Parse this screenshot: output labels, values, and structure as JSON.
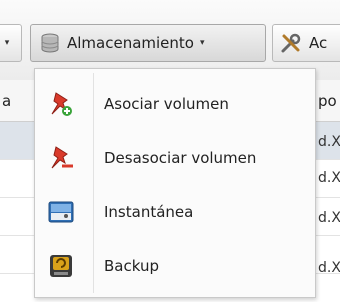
{
  "toolbar": {
    "storage_label": "Almacenamiento",
    "next_label": "Ac",
    "caret": "▾"
  },
  "grid": {
    "header_left": "a",
    "header_right": "po",
    "rows": [
      {
        "right": "d.X"
      },
      {
        "right": "d.X"
      },
      {
        "right": "d.X"
      },
      {
        "right": "d.X"
      }
    ]
  },
  "menu": {
    "items": [
      {
        "label": "Asociar volumen",
        "icon": "pin-add-icon"
      },
      {
        "label": "Desasociar volumen",
        "icon": "pin-remove-icon"
      },
      {
        "label": "Instantánea",
        "icon": "snapshot-icon"
      },
      {
        "label": "Backup",
        "icon": "backup-icon"
      }
    ]
  },
  "colors": {
    "pin_red": "#d93a2b",
    "add_green": "#3aa33a",
    "snapshot_blue": "#2f6fb5",
    "backup_gold": "#d9a21a"
  }
}
